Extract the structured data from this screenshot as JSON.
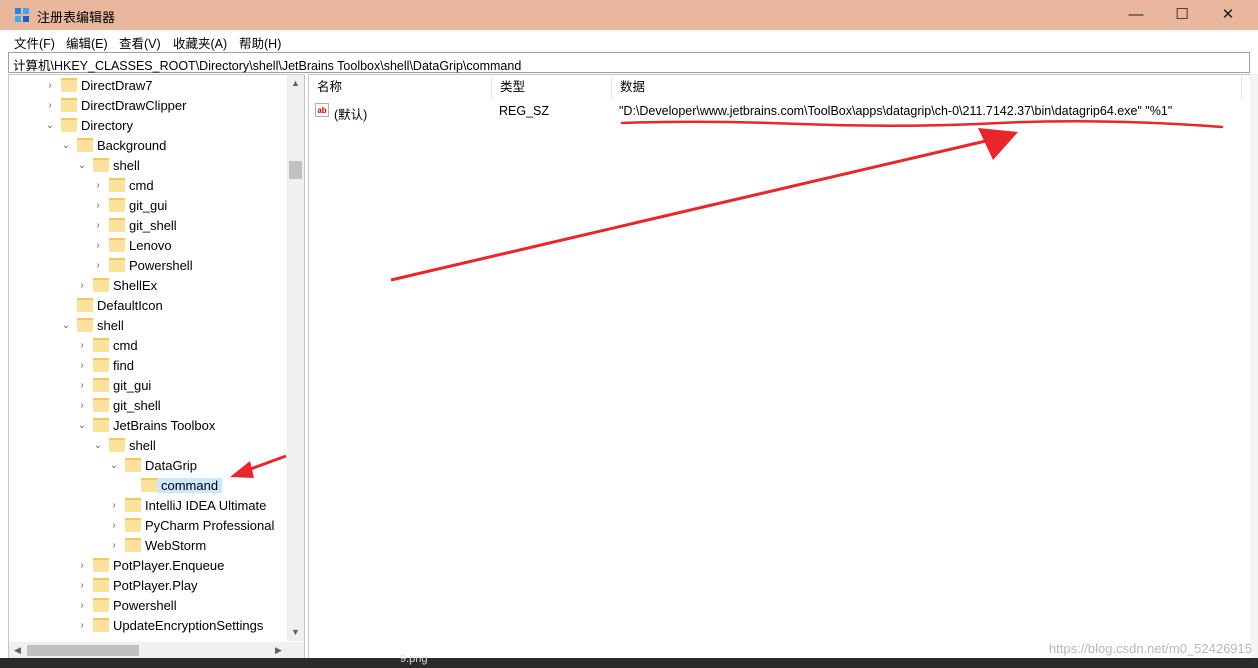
{
  "window": {
    "title": "注册表编辑器",
    "controls": {
      "minimize": "—",
      "maximize": "☐",
      "close": "✕"
    }
  },
  "menu": {
    "items": [
      "文件(F)",
      "编辑(E)",
      "查看(V)",
      "收藏夹(A)",
      "帮助(H)"
    ]
  },
  "address": "计算机\\HKEY_CLASSES_ROOT\\Directory\\shell\\JetBrains Toolbox\\shell\\DataGrip\\command",
  "tree": {
    "nodes": [
      {
        "label": "DirectDraw7",
        "expander": "›"
      },
      {
        "label": "DirectDrawClipper",
        "expander": "›"
      },
      {
        "label": "Directory",
        "expander": "⌄"
      },
      {
        "label": "Background",
        "expander": "⌄"
      },
      {
        "label": "shell",
        "expander": "⌄"
      },
      {
        "label": "cmd",
        "expander": "›"
      },
      {
        "label": "git_gui",
        "expander": "›"
      },
      {
        "label": "git_shell",
        "expander": "›"
      },
      {
        "label": "Lenovo",
        "expander": "›"
      },
      {
        "label": "Powershell",
        "expander": "›"
      },
      {
        "label": "ShellEx",
        "expander": "›"
      },
      {
        "label": "DefaultIcon",
        "expander": ""
      },
      {
        "label": "shell",
        "expander": "⌄"
      },
      {
        "label": "cmd",
        "expander": "›"
      },
      {
        "label": "find",
        "expander": "›"
      },
      {
        "label": "git_gui",
        "expander": "›"
      },
      {
        "label": "git_shell",
        "expander": "›"
      },
      {
        "label": "JetBrains Toolbox",
        "expander": "⌄"
      },
      {
        "label": "shell",
        "expander": "⌄"
      },
      {
        "label": "DataGrip",
        "expander": "⌄"
      },
      {
        "label": "command",
        "expander": "",
        "selected": true
      },
      {
        "label": "IntelliJ IDEA Ultimate",
        "expander": "›"
      },
      {
        "label": "PyCharm Professional",
        "expander": "›"
      },
      {
        "label": "WebStorm",
        "expander": "›"
      },
      {
        "label": "PotPlayer.Enqueue",
        "expander": "›"
      },
      {
        "label": "PotPlayer.Play",
        "expander": "›"
      },
      {
        "label": "Powershell",
        "expander": "›"
      },
      {
        "label": "UpdateEncryptionSettings",
        "expander": "›"
      }
    ]
  },
  "list": {
    "headers": {
      "name": "名称",
      "type": "类型",
      "data": "数据"
    },
    "rows": [
      {
        "icon": "ab",
        "name": "(默认)",
        "type": "REG_SZ",
        "data": "\"D:\\Developer\\www.jetbrains.com\\ToolBox\\apps\\datagrip\\ch-0\\211.7142.37\\bin\\datagrip64.exe\" \"%1\""
      }
    ]
  },
  "scroll": {
    "up": "▲",
    "down": "▼",
    "left": "◀",
    "right": "▶"
  },
  "watermark": "https://blog.csdn.net/m0_52426915",
  "taskbar_file": "9.png",
  "colors": {
    "titlebar": "#e9b79e",
    "folder": "#fbe39d",
    "selection": "#cce8ff",
    "annotation": "#e8262b"
  }
}
